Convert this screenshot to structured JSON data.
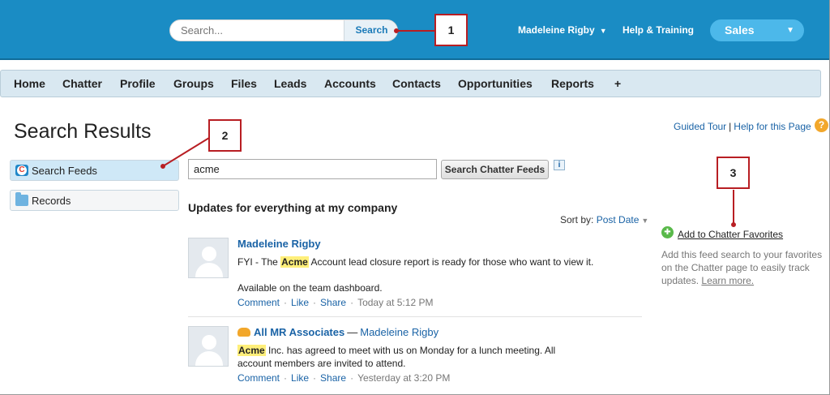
{
  "header": {
    "search_placeholder": "Search...",
    "search_button": "Search",
    "user_name": "Madeleine Rigby",
    "help_link": "Help & Training",
    "app_name": "Sales"
  },
  "tabs": [
    "Home",
    "Chatter",
    "Profile",
    "Groups",
    "Files",
    "Leads",
    "Accounts",
    "Contacts",
    "Opportunities",
    "Reports",
    "+"
  ],
  "page": {
    "title": "Search Results",
    "guided_tour": "Guided Tour",
    "separator": "|",
    "help_page": "Help for this Page",
    "help_icon": "?"
  },
  "sidebar": {
    "items": [
      {
        "label": "Search Feeds",
        "icon": "chatter-icon"
      },
      {
        "label": "Records",
        "icon": "folder-icon"
      }
    ]
  },
  "feed_search": {
    "value": "acme",
    "button": "Search Chatter Feeds",
    "info": "i"
  },
  "feed": {
    "heading": "Updates for everything at my company",
    "sort_label": "Sort by:",
    "sort_value": "Post Date",
    "posts": [
      {
        "author": "Madeleine Rigby",
        "text_before": "FYI - The ",
        "highlight": "Acme",
        "text_after": " Account lead closure report is ready for those who want to view it.",
        "line2": "Available on the team dashboard.",
        "actions": [
          "Comment",
          "Like",
          "Share"
        ],
        "time": "Today at 5:12 PM"
      },
      {
        "group": "All MR Associates",
        "dash": "—",
        "author": "Madeleine Rigby",
        "highlight": "Acme",
        "text_after": " Inc. has agreed to meet with us on Monday for a lunch meeting. All account members are invited to attend.",
        "actions": [
          "Comment",
          "Like",
          "Share"
        ],
        "time": "Yesterday at 3:20 PM"
      }
    ]
  },
  "favorites": {
    "link": "Add to Chatter Favorites",
    "description": "Add this feed search to your favorites on the Chatter page to easily track updates.",
    "learn_more": "Learn more."
  },
  "callouts": [
    "1",
    "2",
    "3"
  ],
  "colors": {
    "header": "#1a8cc4",
    "callout": "#b81e23",
    "highlight": "#ffef7a",
    "link": "#1a63a6"
  }
}
